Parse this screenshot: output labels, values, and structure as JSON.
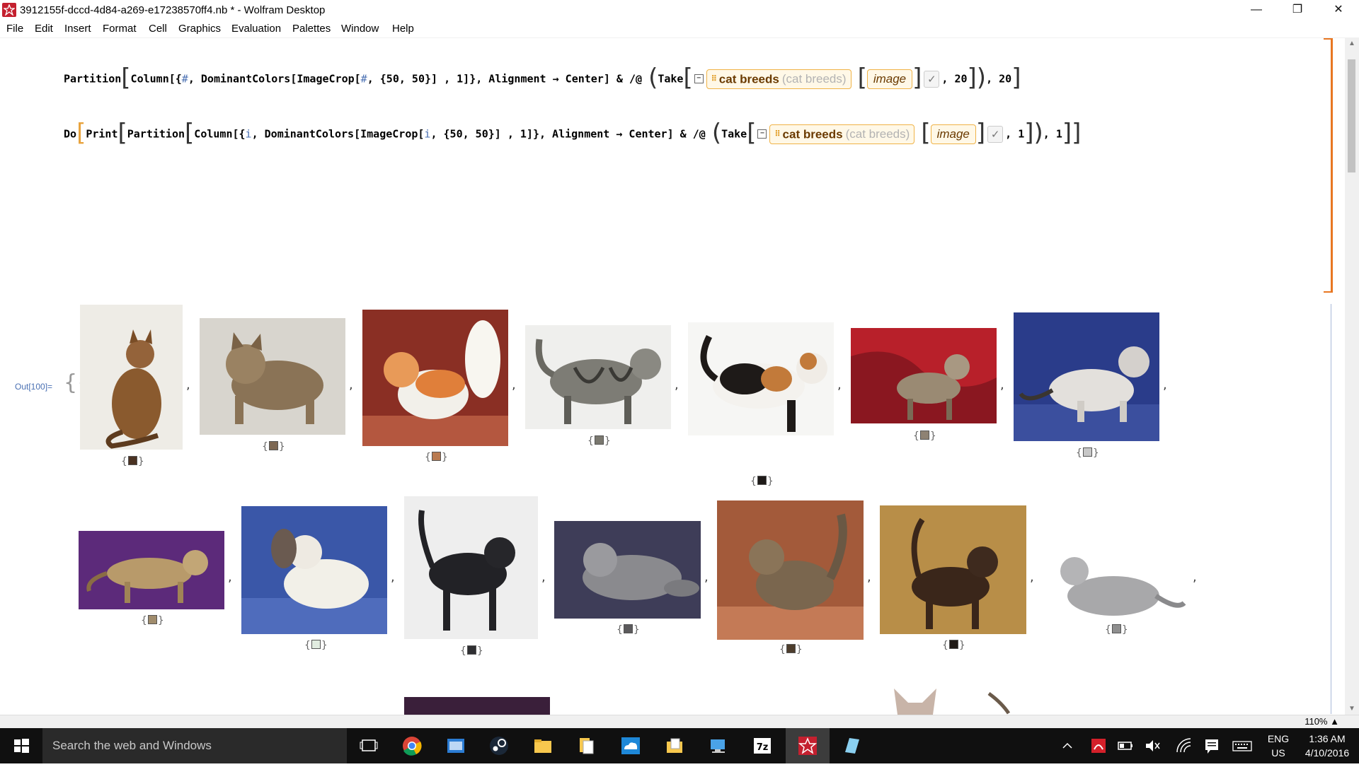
{
  "window": {
    "title": "3912155f-dccd-4d84-a269-e17238570ff4.nb * - Wolfram Desktop",
    "minimize_glyph": "—",
    "restore_glyph": "❐",
    "close_glyph": "✕"
  },
  "menu": [
    "File",
    "Edit",
    "Insert",
    "Format",
    "Cell",
    "Graphics",
    "Evaluation",
    "Palettes",
    "Window",
    "Help"
  ],
  "code": {
    "line1": {
      "fn": "Partition",
      "col": "Column",
      "open": "[{",
      "slot1": "#",
      "mid1": ", DominantColors[ImageCrop[",
      "slot2": "#",
      "mid2": ", {50, 50}] , 1]}, Alignment → Center] & /@",
      "take": "Take",
      "tail": ", 20",
      "end": ", 20"
    },
    "line2": {
      "do": "Do",
      "print": "Print",
      "fn": "Partition",
      "col": "Column",
      "open": "[{",
      "var1": "i",
      "mid1": ", DominantColors[ImageCrop[",
      "var2": "i",
      "mid2": ", {50, 50}] , 1]}, Alignment → Center] & /@",
      "take": "Take",
      "tail": ", 1",
      "end": ", 1"
    },
    "entity_name": "cat breeds",
    "entity_interp": "(cat breeds)",
    "property": "image",
    "check": "✓",
    "minus": "−",
    "grid_glyph": "⠿"
  },
  "output": {
    "label": "Out[100]=",
    "open_brace": "{{",
    "comma": ",",
    "row1": [
      {
        "swatch": "#4a3222"
      },
      {
        "swatch": "#7d6853"
      },
      {
        "swatch": "#b97a50"
      },
      {
        "swatch": "#7a786f"
      },
      {
        "swatch": "#1e1a18"
      },
      {
        "swatch": "#8e8273"
      },
      {
        "swatch": "#c7c7c7"
      }
    ],
    "row2": [
      {
        "swatch": "#a08c6c"
      },
      {
        "swatch": "#e1ece0"
      },
      {
        "swatch": "#2f2f32"
      },
      {
        "swatch": "#5b5a5c"
      },
      {
        "swatch": "#4d3d2d"
      },
      {
        "swatch": "#1f1a16"
      },
      {
        "swatch": "#8f8f8f"
      }
    ],
    "swatch_open": "{",
    "swatch_close": "}"
  },
  "statusbar": {
    "zoom": "110%",
    "zoom_arrow": "▲"
  },
  "taskbar": {
    "search_placeholder": "Search the web and Windows",
    "lang": "ENG",
    "region": "US",
    "time": "1:36 AM",
    "date": "4/10/2016"
  },
  "colors": {
    "accent_orange": "#f0b347",
    "cell_bracket": "#e87722",
    "wolfram_red": "#c4202f",
    "label_blue": "#4a70b3"
  }
}
